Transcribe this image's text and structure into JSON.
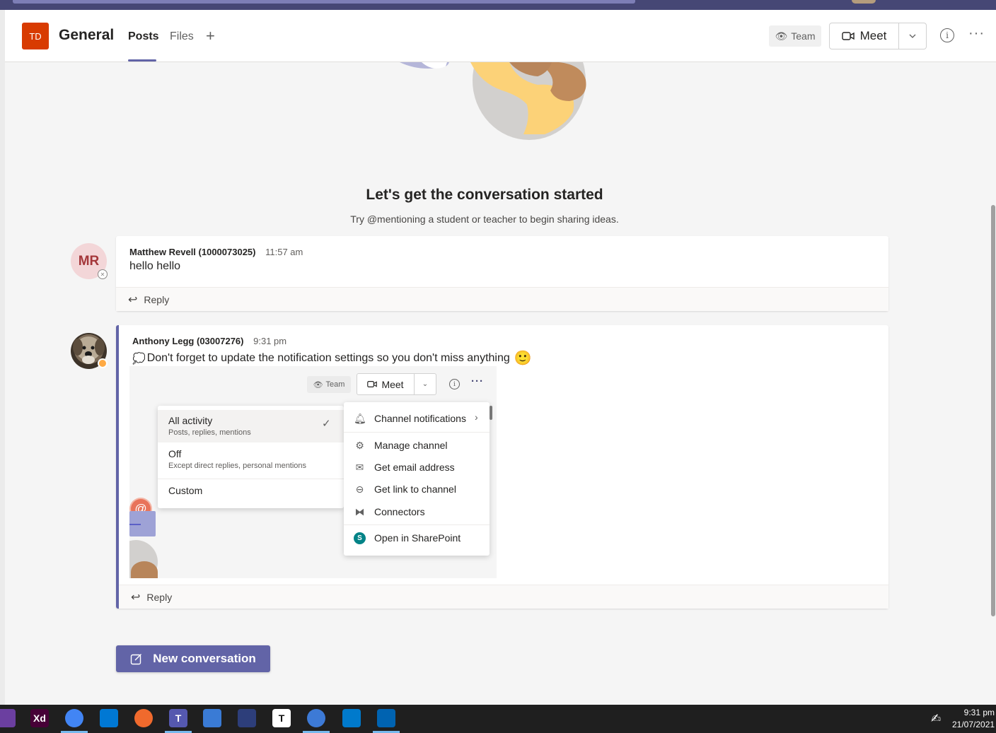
{
  "header": {
    "team_initials": "TD",
    "channel_name": "General",
    "tabs": [
      {
        "label": "Posts",
        "active": true
      },
      {
        "label": "Files",
        "active": false
      }
    ],
    "add_tab_icon": "plus-icon",
    "team_label": "Team",
    "meet_label": "Meet",
    "info_icon": "info-icon",
    "more_icon": "more-icon"
  },
  "empty_state": {
    "title": "Let's get the conversation started",
    "subtitle": "Try @mentioning a student or teacher to begin sharing ideas."
  },
  "posts": [
    {
      "avatar_initials": "MR",
      "author": "Matthew Revell (1000073025)",
      "time": "11:57 am",
      "text": "hello hello",
      "reply_label": "Reply",
      "presence": "offline"
    },
    {
      "author": "Anthony Legg (03007276)",
      "time": "9:31 pm",
      "text": "Don't forget to update the notification settings so you don't miss anything",
      "emoji": "🙂",
      "reply_label": "Reply",
      "presence": "away",
      "embedded_image": {
        "team_label": "Team",
        "meet_label": "Meet",
        "notification_options": [
          {
            "title": "All activity",
            "subtitle": "Posts, replies, mentions",
            "checked": true
          },
          {
            "title": "Off",
            "subtitle": "Except direct replies, personal mentions",
            "checked": false
          },
          {
            "title": "Custom",
            "subtitle": "",
            "checked": false
          }
        ],
        "channel_menu": [
          {
            "label": "Channel notifications",
            "icon": "bell-icon"
          },
          {
            "label": "Manage channel",
            "icon": "gear-icon"
          },
          {
            "label": "Get email address",
            "icon": "mail-icon"
          },
          {
            "label": "Get link to channel",
            "icon": "link-icon"
          },
          {
            "label": "Connectors",
            "icon": "connector-icon"
          },
          {
            "label": "Open in SharePoint",
            "icon": "sharepoint-icon"
          }
        ]
      }
    }
  ],
  "new_conversation_label": "New conversation",
  "taskbar": {
    "time": "9:31 pm",
    "date": "21/07/2021",
    "apps": [
      {
        "name": "affinity-icon",
        "glyph": "",
        "color": "#6b3fa0"
      },
      {
        "name": "adobe-xd-icon",
        "glyph": "Xd",
        "color": "#470137"
      },
      {
        "name": "chrome-icon",
        "glyph": "",
        "color": "#4285f4"
      },
      {
        "name": "app-icon",
        "glyph": "",
        "color": "#0078d4"
      },
      {
        "name": "pen-app-icon",
        "glyph": "",
        "color": "#f06a2d"
      },
      {
        "name": "teams-icon",
        "glyph": "T",
        "color": "#5558af"
      },
      {
        "name": "network-icon",
        "glyph": "",
        "color": "#3a7bd5"
      },
      {
        "name": "clapper-icon",
        "glyph": "",
        "color": "#2d3e7a"
      },
      {
        "name": "typora-icon",
        "glyph": "T",
        "color": "#ffffff"
      },
      {
        "name": "firefox-icon",
        "glyph": "",
        "color": "#3d7ad6"
      },
      {
        "name": "vscode-icon",
        "glyph": "",
        "color": "#007acc"
      },
      {
        "name": "photos-icon",
        "glyph": "",
        "color": "#0063b1"
      }
    ]
  },
  "colors": {
    "brand": "#6264a7",
    "team_tile": "#d83b01",
    "titlebar": "#464775"
  }
}
